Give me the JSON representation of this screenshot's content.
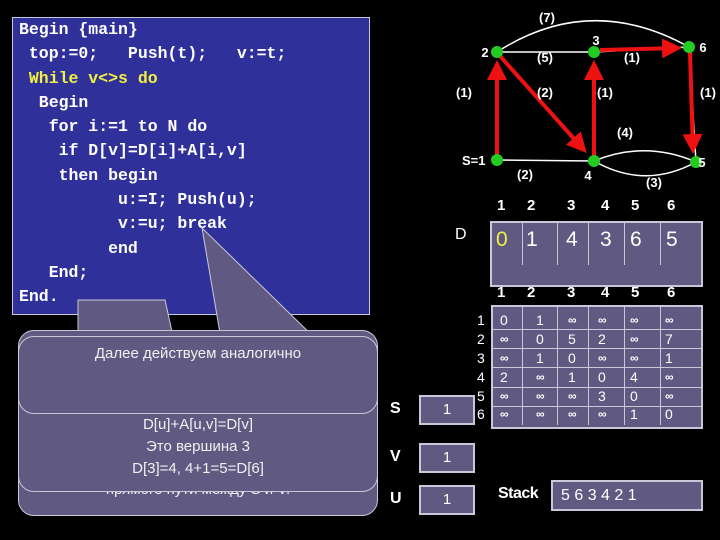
{
  "code": {
    "lines": [
      {
        "text": "Begin {main}",
        "highlight": false
      },
      {
        "text": " top:=0;   Push(t);   v:=t;",
        "highlight": false
      },
      {
        "text": " While v<>s do",
        "highlight": true
      },
      {
        "text": "  Begin",
        "highlight": false
      },
      {
        "text": "   for i:=1 to N do",
        "highlight": false
      },
      {
        "text": "    if D[v]=D[i]+A[i,v]",
        "highlight": false
      },
      {
        "text": "    then begin",
        "highlight": false
      },
      {
        "text": "          u:=I; Push(u);",
        "highlight": false
      },
      {
        "text": "          v:=u; break",
        "highlight": false
      },
      {
        "text": "         end",
        "highlight": false
      },
      {
        "text": "   End;",
        "highlight": false
      },
      {
        "text": "End.",
        "highlight": false
      }
    ],
    "highlight_color": "#f0f040"
  },
  "callouts": {
    "bottom": "прямого пути между S и V.",
    "middle": [
      "D[u]+A[u,v]=D[v]",
      "Это вершина 3",
      "D[3]=4, 4+1=5=D[6]"
    ],
    "top": "Далее действуем аналогично"
  },
  "graph": {
    "nodes": [
      {
        "id": "1",
        "label": "S=1"
      },
      {
        "id": "2",
        "label": "2"
      },
      {
        "id": "3",
        "label": "3"
      },
      {
        "id": "4",
        "label": "4"
      },
      {
        "id": "5",
        "label": "5"
      },
      {
        "id": "6",
        "label": "6"
      }
    ],
    "edges": [
      {
        "from": "2",
        "to": "6",
        "weight": "(7)",
        "highlighted": false
      },
      {
        "from": "2",
        "to": "3",
        "weight": "(5)",
        "highlighted": false
      },
      {
        "from": "3",
        "to": "6",
        "weight": "(1)",
        "highlighted": true
      },
      {
        "from": "1",
        "to": "2",
        "weight": "(1)",
        "highlighted": true
      },
      {
        "from": "2",
        "to": "4",
        "weight": "(2)",
        "highlighted": true
      },
      {
        "from": "4",
        "to": "3",
        "weight": "(1)",
        "highlighted": true
      },
      {
        "from": "6",
        "to": "5",
        "weight": "(1)",
        "highlighted": true
      },
      {
        "from": "4",
        "to": "5",
        "weight": "(4)",
        "highlighted": false
      },
      {
        "from": "1",
        "to": "4",
        "weight": "(2)",
        "highlighted": false
      },
      {
        "from": "5",
        "to": "4",
        "weight": "(3)",
        "highlighted": false
      }
    ],
    "node_color": "#22cc22",
    "path_color": "#ee1111"
  },
  "d_array": {
    "label": "D",
    "indices": [
      "1",
      "2",
      "3",
      "4",
      "5",
      "6"
    ],
    "values": [
      "0",
      "1",
      "4",
      "3",
      "6",
      "5"
    ],
    "first_value_color": "#f0f040"
  },
  "matrix": {
    "col_headers": [
      "1",
      "2",
      "3",
      "4",
      "5",
      "6"
    ],
    "row_headers": [
      "1",
      "2",
      "3",
      "4",
      "5",
      "6"
    ],
    "rows": [
      [
        "0",
        "1",
        "∞",
        "∞",
        "∞",
        "∞"
      ],
      [
        "∞",
        "0",
        "5",
        "2",
        "∞",
        "7"
      ],
      [
        "∞",
        "1",
        "0",
        "∞",
        "∞",
        "1"
      ],
      [
        "2",
        "∞",
        "1",
        "0",
        "4",
        "∞"
      ],
      [
        "∞",
        "∞",
        "∞",
        "3",
        "0",
        "∞"
      ],
      [
        "∞",
        "∞",
        "∞",
        "∞",
        "1",
        "0"
      ]
    ]
  },
  "vars": {
    "s": {
      "label": "S",
      "value": "1"
    },
    "v": {
      "label": "V",
      "value": "1"
    },
    "u": {
      "label": "U",
      "value": "1"
    },
    "stack": {
      "label": "Stack",
      "value": "5 6 3 4 2 1"
    }
  }
}
